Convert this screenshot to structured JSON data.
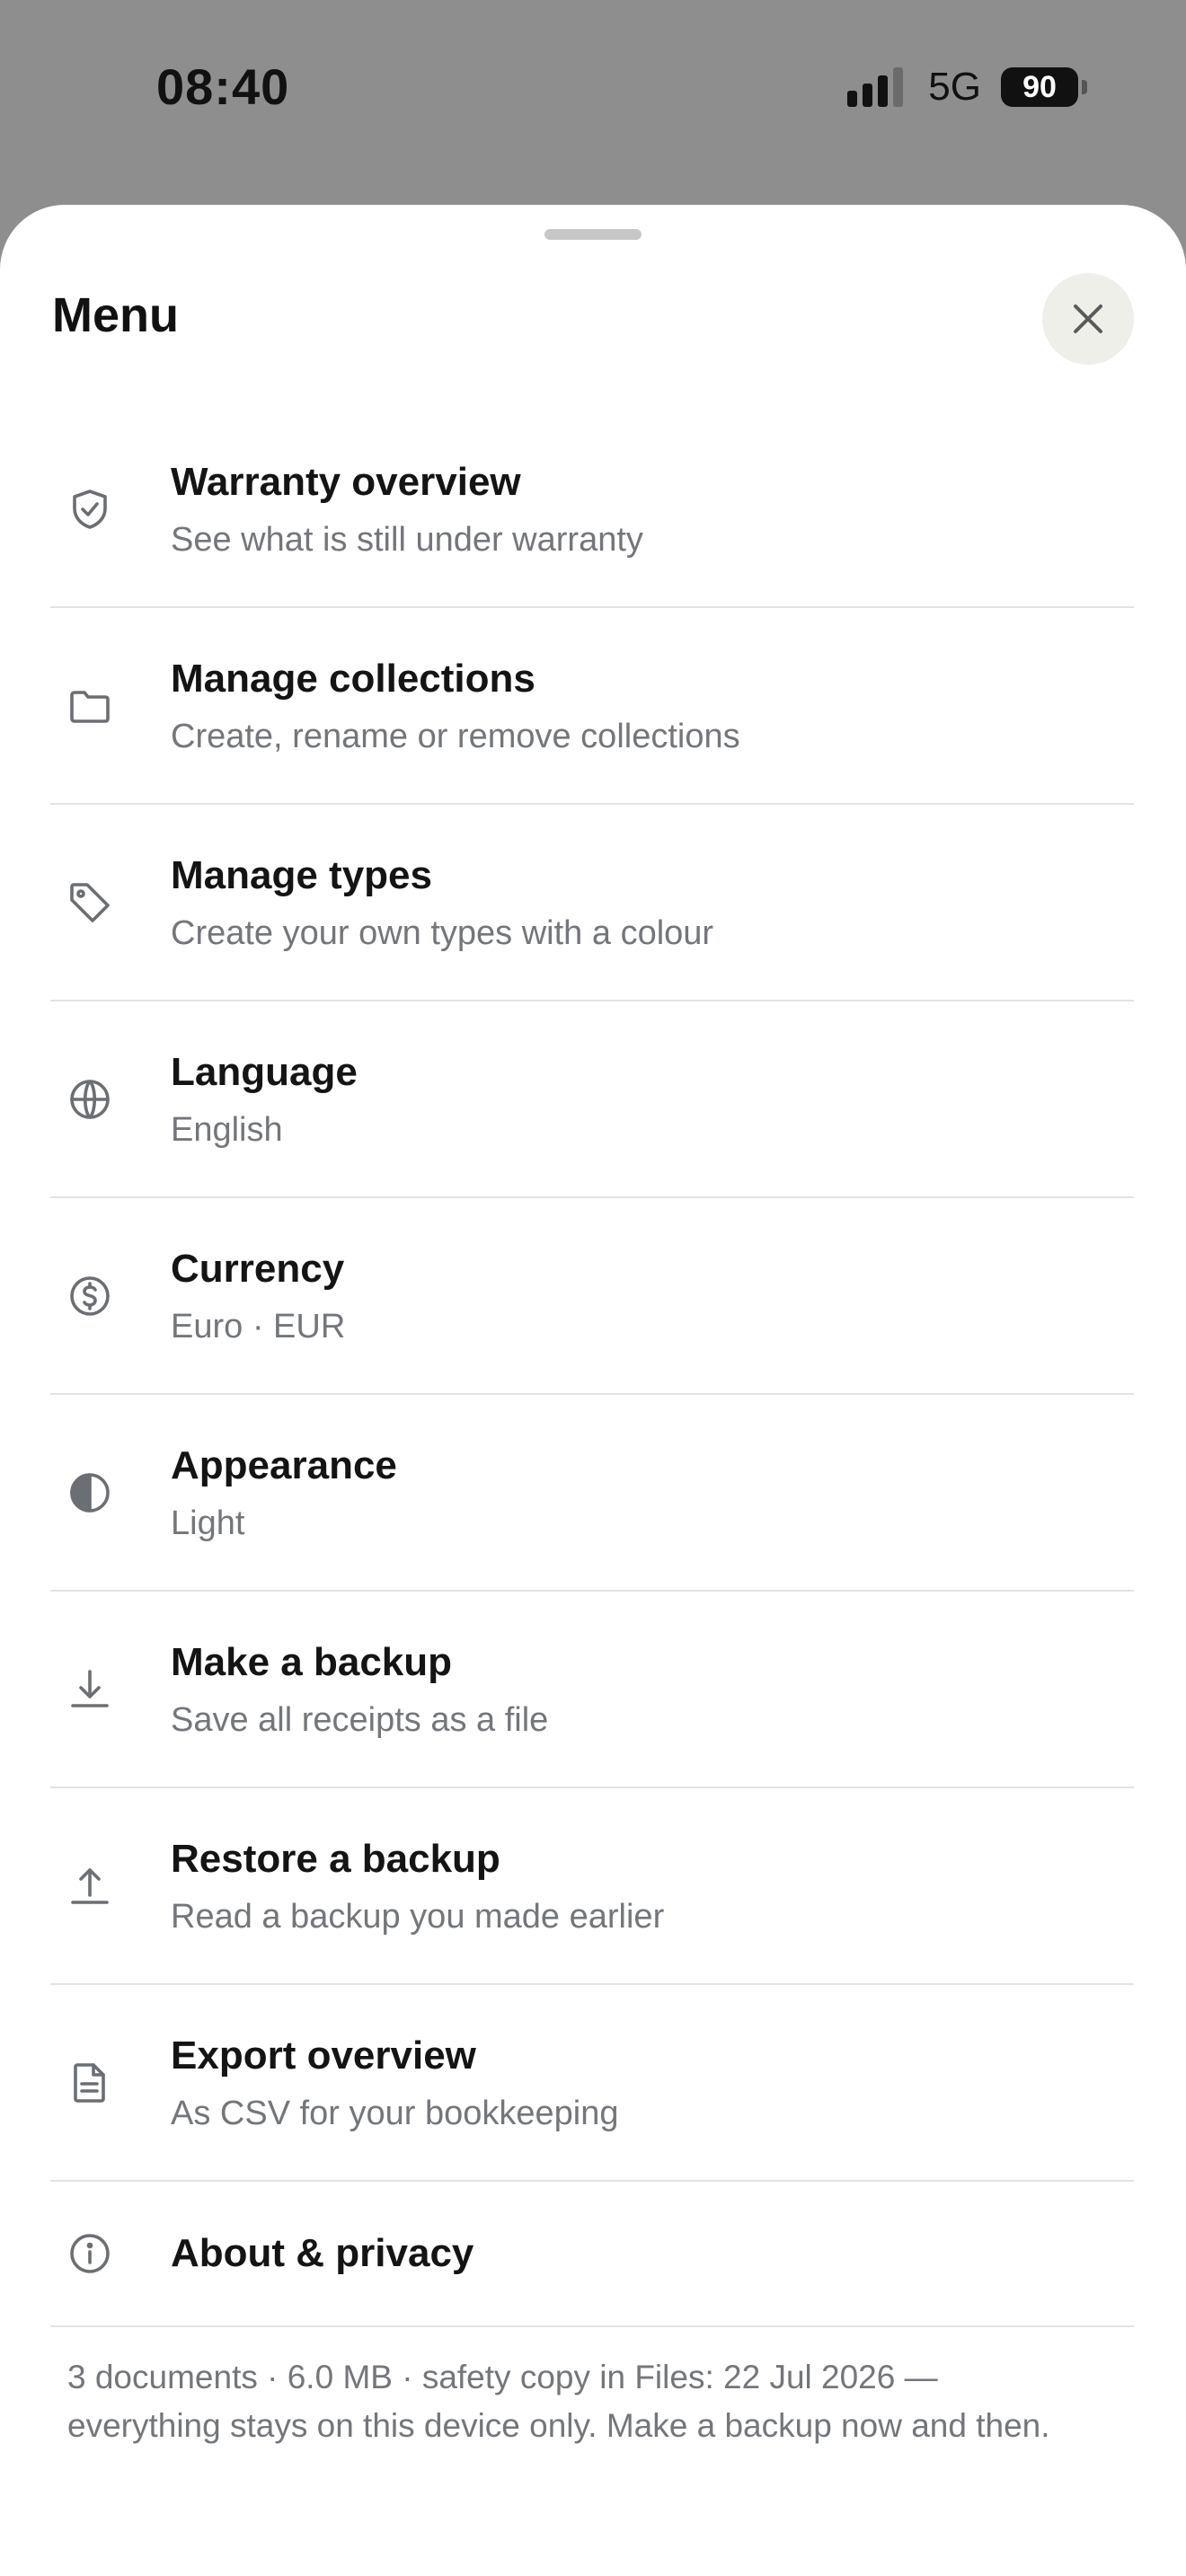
{
  "status_bar": {
    "time": "08:40",
    "network": "5G",
    "battery": "90"
  },
  "sheet": {
    "title": "Menu",
    "close_icon": "close-icon"
  },
  "menu": {
    "items": [
      {
        "label": "Warranty overview",
        "sub": "See what is still under warranty",
        "icon": "shield-check-icon"
      },
      {
        "label": "Manage collections",
        "sub": "Create, rename or remove collections",
        "icon": "folder-icon"
      },
      {
        "label": "Manage types",
        "sub": "Create your own types with a colour",
        "icon": "tag-icon"
      },
      {
        "label": "Language",
        "sub": "English",
        "icon": "globe-icon"
      },
      {
        "label": "Currency",
        "sub": "Euro · EUR",
        "icon": "dollar-circle-icon"
      },
      {
        "label": "Appearance",
        "sub": "Light",
        "icon": "contrast-icon"
      },
      {
        "label": "Make a backup",
        "sub": "Save all receipts as a file",
        "icon": "download-icon"
      },
      {
        "label": "Restore a backup",
        "sub": "Read a backup you made earlier",
        "icon": "upload-icon"
      },
      {
        "label": "Export overview",
        "sub": "As CSV for your bookkeeping",
        "icon": "document-icon"
      },
      {
        "label": "About & privacy",
        "icon": "info-icon"
      }
    ]
  },
  "footer": {
    "note": "3 documents · 6.0 MB · safety copy in Files: 22 Jul 2026 — everything stays on this device only. Make a backup now and then."
  },
  "colors": {
    "backdrop": "#8e8e8e",
    "sheet": "#ffffff",
    "subtext": "#73767a",
    "divider": "#e3e3e3",
    "close_bg": "#efefea"
  }
}
